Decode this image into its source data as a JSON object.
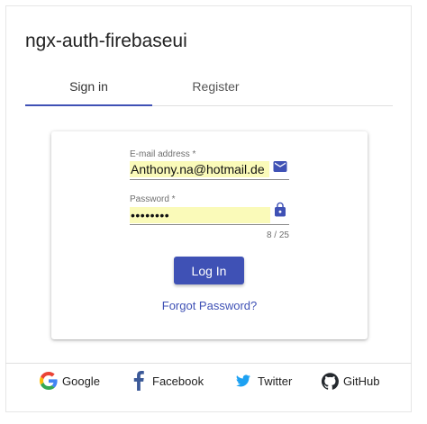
{
  "app": {
    "title": "ngx-auth-firebaseui"
  },
  "tabs": [
    {
      "label": "Sign in",
      "active": true
    },
    {
      "label": "Register",
      "active": false
    }
  ],
  "form": {
    "email_label": "E-mail address *",
    "email_value": "Anthony.na@hotmail.de",
    "email_icon": "mail-icon",
    "password_label": "Password *",
    "password_value": "••••••••",
    "password_icon": "lock-icon",
    "password_counter": "8 / 25",
    "login_label": "Log In",
    "forgot_label": "Forgot Password?"
  },
  "providers": [
    {
      "label": "Google",
      "icon": "google-icon"
    },
    {
      "label": "Facebook",
      "icon": "facebook-icon"
    },
    {
      "label": "Twitter",
      "icon": "twitter-icon"
    },
    {
      "label": "GitHub",
      "icon": "github-icon"
    }
  ],
  "colors": {
    "accent": "#3f51b5",
    "autofill": "#fafab9",
    "facebook": "#3b5998",
    "twitter": "#1da1f2",
    "github": "#24292e"
  }
}
